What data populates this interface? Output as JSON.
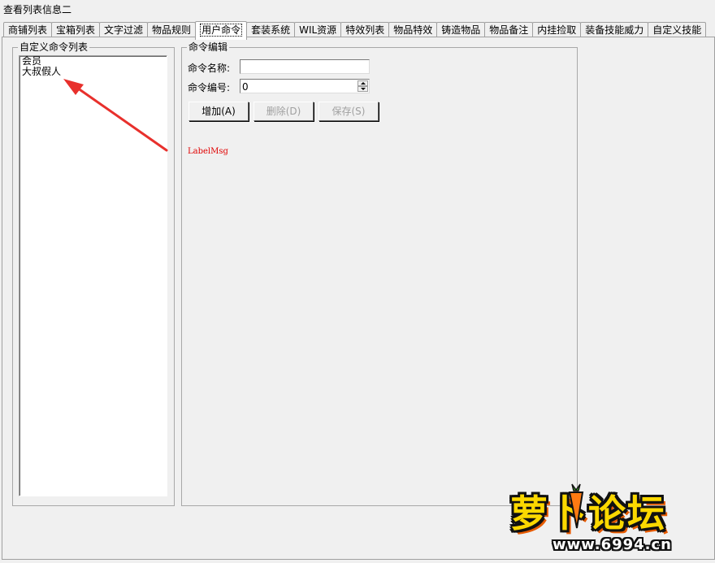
{
  "window": {
    "title": "查看列表信息二"
  },
  "tabs": [
    {
      "label": "商铺列表"
    },
    {
      "label": "宝箱列表"
    },
    {
      "label": "文字过滤"
    },
    {
      "label": "物品规则"
    },
    {
      "label": "用户命令",
      "active": true
    },
    {
      "label": "套装系统"
    },
    {
      "label": "WIL资源"
    },
    {
      "label": "特效列表"
    },
    {
      "label": "物品特效"
    },
    {
      "label": "铸造物品"
    },
    {
      "label": "物品备注"
    },
    {
      "label": "内挂捡取"
    },
    {
      "label": "装备技能威力"
    },
    {
      "label": "自定义技能"
    }
  ],
  "left_group": {
    "title": "自定义命令列表",
    "items": [
      "会员",
      "大叔假人"
    ]
  },
  "editor": {
    "title": "命令编辑",
    "name_label": "命令名称:",
    "name_value": "",
    "number_label": "命令编号:",
    "number_value": "0",
    "add_button": "增加(A)",
    "delete_button": "删除(D)",
    "save_button": "保存(S)",
    "message": "LabelMsg"
  },
  "watermark": {
    "logo_text": "萝卜论坛",
    "url": "www.6994.cn"
  },
  "colors": {
    "message": "#e00000",
    "arrow": "#e8302c",
    "logo": "#fbd800"
  }
}
